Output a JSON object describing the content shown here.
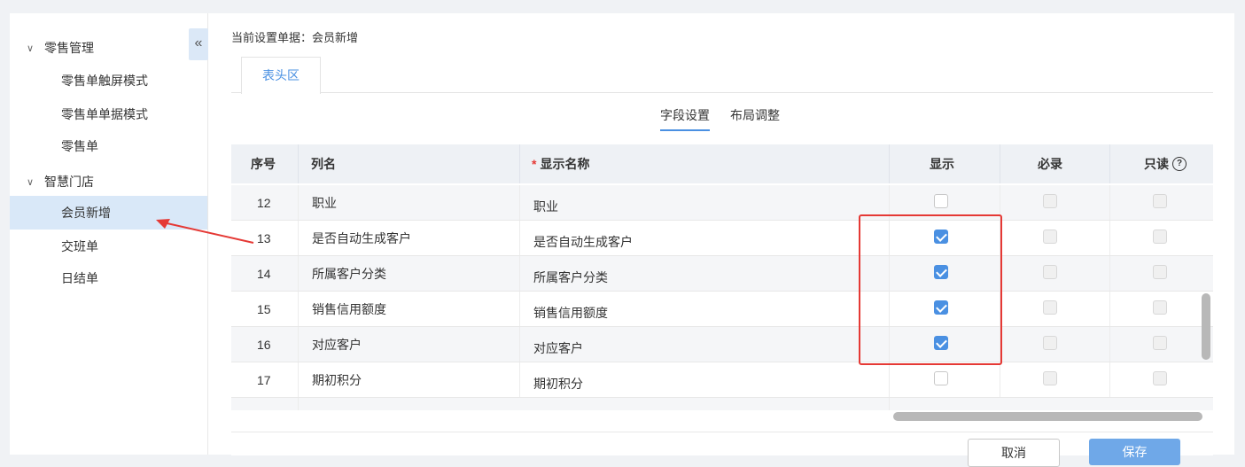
{
  "sidebar": {
    "collapse_label": "«",
    "groups": [
      {
        "label": "零售管理",
        "items": [
          "零售单触屏模式",
          "零售单单据模式",
          "零售单"
        ]
      },
      {
        "label": "智慧门店",
        "items": [
          "会员新增",
          "交班单",
          "日结单"
        ]
      }
    ],
    "active_item": "会员新增"
  },
  "header": {
    "current_doc": "当前设置单据：会员新增",
    "tab_head": "表头区",
    "subtabs": {
      "fields": "字段设置",
      "layout": "布局调整"
    },
    "active_subtab": "字段设置"
  },
  "table": {
    "columns": {
      "no": "序号",
      "name": "列名",
      "required_mark": "*",
      "display_name": "显示名称",
      "show": "显示",
      "must": "必录",
      "readonly": "只读"
    },
    "readonly_help_icon": "question-circle-icon",
    "rows": [
      {
        "no": "12",
        "name": "职业",
        "display_name": "职业",
        "show": false
      },
      {
        "no": "13",
        "name": "是否自动生成客户",
        "display_name": "是否自动生成客户",
        "show": true
      },
      {
        "no": "14",
        "name": "所属客户分类",
        "display_name": "所属客户分类",
        "show": true
      },
      {
        "no": "15",
        "name": "销售信用额度",
        "display_name": "销售信用额度",
        "show": true
      },
      {
        "no": "16",
        "name": "对应客户",
        "display_name": "对应客户",
        "show": true
      },
      {
        "no": "17",
        "name": "期初积分",
        "display_name": "期初积分",
        "show": false
      }
    ]
  },
  "footer": {
    "cancel": "取消",
    "save": "保存"
  },
  "colors": {
    "accent": "#4a90e2",
    "highlight": "#e53935",
    "active_bg": "#d9e8f8"
  }
}
